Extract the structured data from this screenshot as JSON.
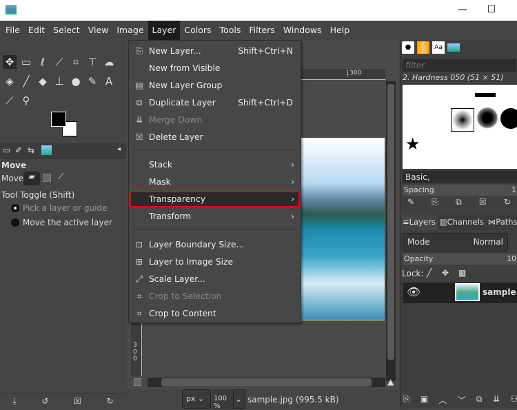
{
  "window": {
    "minimize": "—",
    "maximize": "☐"
  },
  "menubar": [
    "File",
    "Edit",
    "Select",
    "View",
    "Image",
    "Layer",
    "Colors",
    "Tools",
    "Filters",
    "Windows",
    "Help"
  ],
  "layer_menu": {
    "items": [
      {
        "label": "New Layer...",
        "shortcut": "Shift+Ctrl+N",
        "icon": "new-layer-icon"
      },
      {
        "label": "New from Visible",
        "shortcut": ""
      },
      {
        "label": "New Layer Group",
        "shortcut": "",
        "icon": "folder-icon"
      },
      {
        "label": "Duplicate Layer",
        "shortcut": "Shift+Ctrl+D",
        "icon": "duplicate-icon"
      },
      {
        "label": "Merge Down",
        "shortcut": "",
        "disabled": true
      },
      {
        "label": "Delete Layer",
        "shortcut": "",
        "icon": "delete-icon"
      },
      {
        "label": "Stack",
        "submenu": true
      },
      {
        "label": "Mask",
        "submenu": true
      },
      {
        "label": "Transparency",
        "submenu": true,
        "highlighted": true
      },
      {
        "label": "Transform",
        "submenu": true
      },
      {
        "label": "Layer Boundary Size..."
      },
      {
        "label": "Layer to Image Size"
      },
      {
        "label": "Scale Layer..."
      },
      {
        "label": "Crop to Selection",
        "disabled": true
      },
      {
        "label": "Crop to Content"
      }
    ]
  },
  "tool_options": {
    "title": "Move",
    "move_label": "Move:",
    "toggle_label": "Tool Toggle  (Shift)",
    "options": [
      "Pick a layer or guide",
      "Move the active layer"
    ]
  },
  "canvas": {
    "ruler_top": "300",
    "ruler_left": "300",
    "unit": "px",
    "zoom": "100 %",
    "status": "sample.jpg (995.5 kB)"
  },
  "brushes": {
    "filter_placeholder": "filter",
    "current": "2. Hardness 050 (51 × 51)",
    "preset": "Basic,",
    "spacing_label": "Spacing",
    "spacing_value": "1"
  },
  "layers": {
    "tabs": [
      "Layers",
      "Channels",
      "Paths"
    ],
    "mode_label": "Mode",
    "mode_value": "Normal",
    "opacity_label": "Opacity",
    "opacity_value": "10",
    "lock_label": "Lock:",
    "layer_name": "sample.jpg"
  },
  "colors": {
    "highlight_border": "#e00000",
    "menu_bg": "#474747"
  }
}
